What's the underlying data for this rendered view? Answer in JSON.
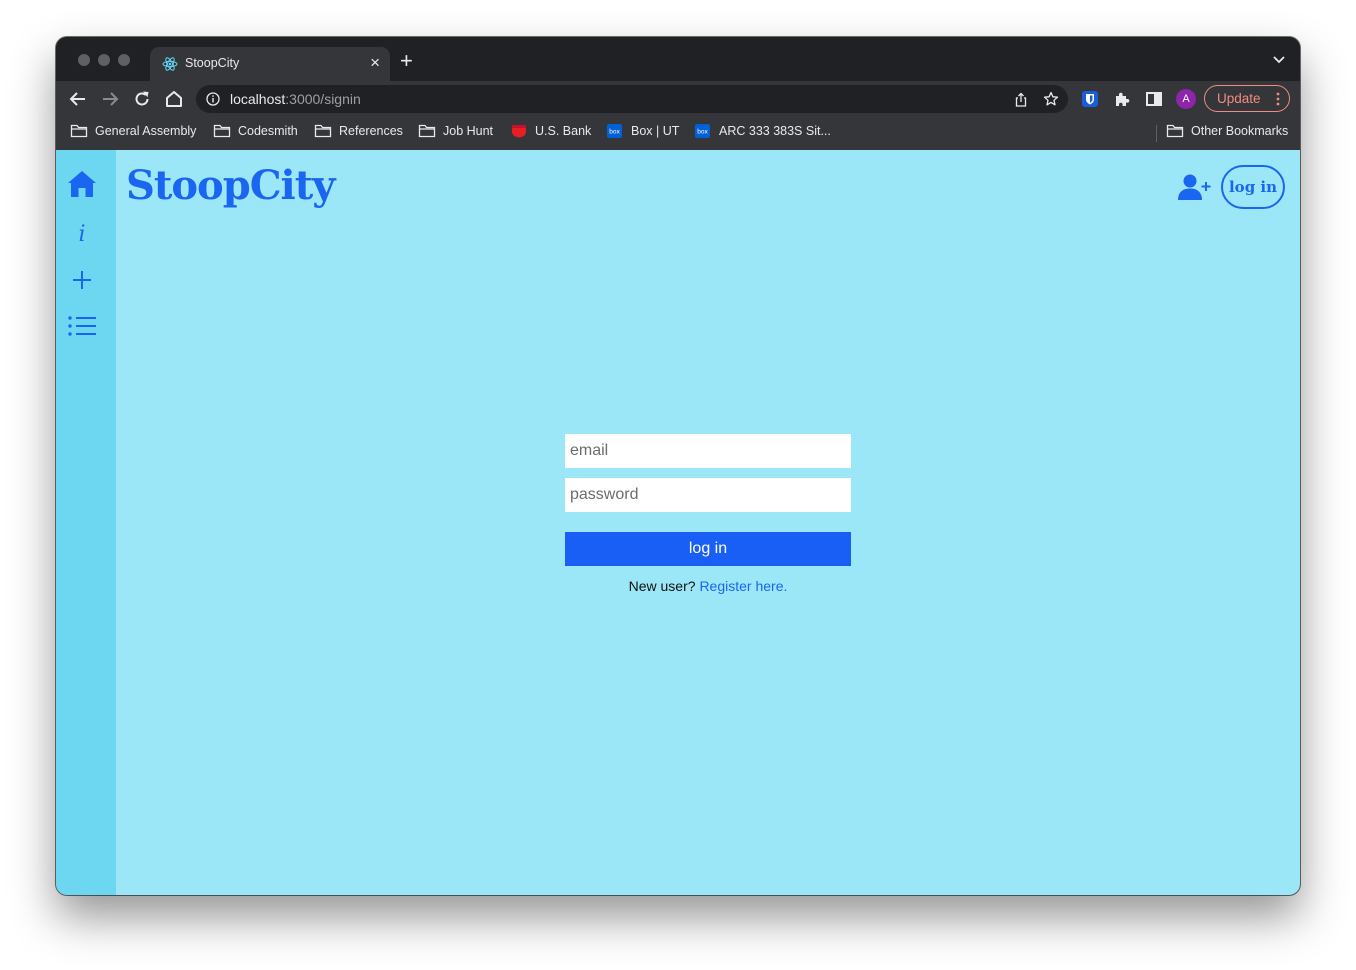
{
  "browser": {
    "tab": {
      "title": "StoopCity",
      "close_glyph": "×"
    },
    "new_tab_glyph": "+",
    "url": {
      "host": "localhost",
      "rest": ":3000/signin"
    },
    "profile_initial": "A",
    "update_label": "Update",
    "bookmarks": [
      {
        "label": "General Assembly",
        "icon": "folder-icon"
      },
      {
        "label": "Codesmith",
        "icon": "folder-icon"
      },
      {
        "label": "References",
        "icon": "folder-icon"
      },
      {
        "label": "Job Hunt",
        "icon": "folder-icon"
      },
      {
        "label": "U.S. Bank",
        "icon": "usbank-icon",
        "color": "#e81e25"
      },
      {
        "label": "Box | UT",
        "icon": "box-icon",
        "color": "#0061d5"
      },
      {
        "label": "ARC 333 383S Sit...",
        "icon": "box-icon",
        "color": "#0061d5"
      }
    ],
    "other_bookmarks": "Other Bookmarks"
  },
  "app": {
    "brand": "StoopCity",
    "header": {
      "login_label": "log in"
    },
    "side_nav": [
      "home-icon",
      "info-icon",
      "plus-icon",
      "list-icon"
    ],
    "form": {
      "email_placeholder": "email",
      "password_placeholder": "password",
      "submit_label": "log in",
      "register_prompt": "New user?",
      "register_link": "Register here."
    },
    "colors": {
      "page_bg": "#9be7f8",
      "sidebar_bg": "#6dd7f1",
      "accent": "#1a66f0",
      "button": "#1a5ff5"
    }
  }
}
